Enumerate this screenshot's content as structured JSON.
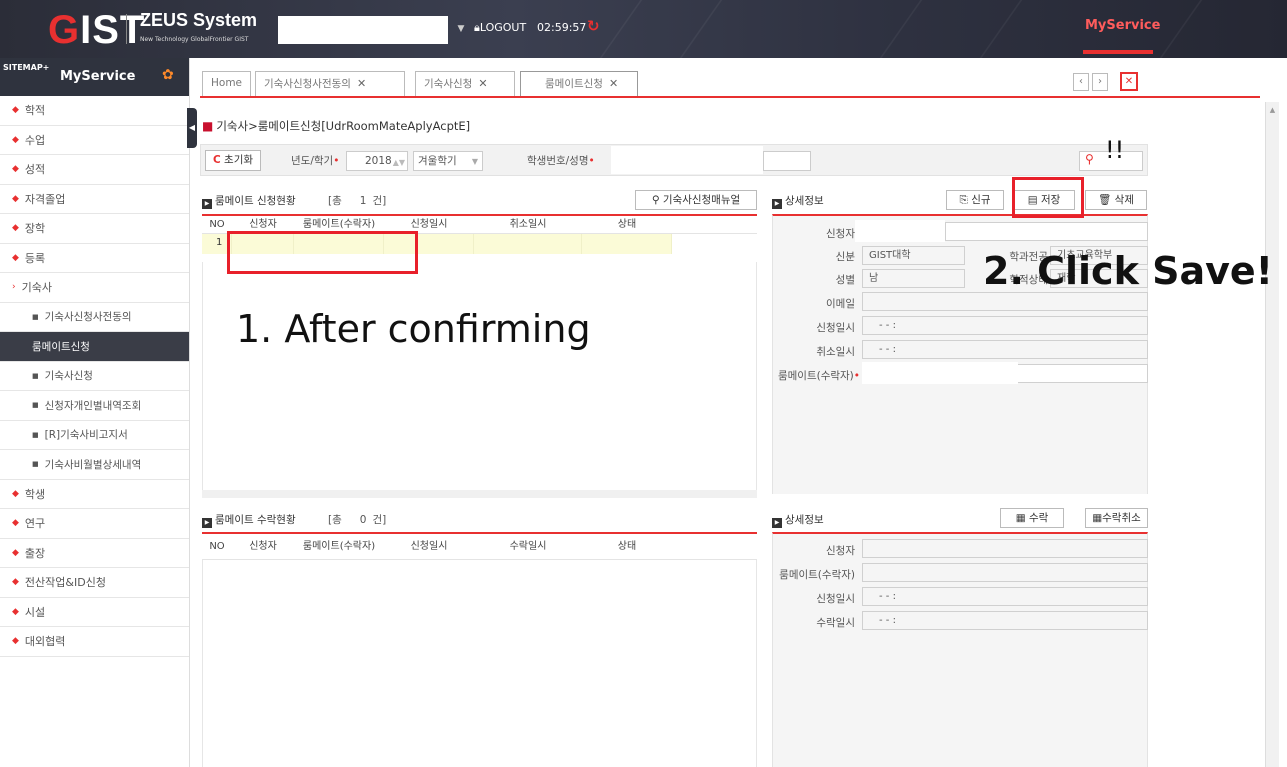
{
  "header": {
    "logo": {
      "g": "G",
      "rest": "IST"
    },
    "system_name": "ZEUS System",
    "system_sub": "New Technology GlobalFrontier GIST",
    "logout": "LOGOUT",
    "timer": "02:59:57",
    "myservice": "MyService"
  },
  "sidebar": {
    "sitemap": "SITEMAP+",
    "title": "MyService",
    "items": [
      {
        "label": "학적",
        "level": 1
      },
      {
        "label": "수업",
        "level": 1
      },
      {
        "label": "성적",
        "level": 1
      },
      {
        "label": "자격졸업",
        "level": 1
      },
      {
        "label": "장학",
        "level": 1
      },
      {
        "label": "등록",
        "level": 1
      },
      {
        "label": "기숙사",
        "level": 1,
        "open": true
      },
      {
        "label": "기숙사신청사전동의",
        "level": 2
      },
      {
        "label": "룸메이트신청",
        "level": 2,
        "active": true
      },
      {
        "label": "기숙사신청",
        "level": 2
      },
      {
        "label": "신청자개인별내역조회",
        "level": 2
      },
      {
        "label": "[R]기숙사비고지서",
        "level": 2
      },
      {
        "label": "기숙사비월별상세내역",
        "level": 2
      },
      {
        "label": "학생",
        "level": 1
      },
      {
        "label": "연구",
        "level": 1
      },
      {
        "label": "출장",
        "level": 1
      },
      {
        "label": "전산작업&ID신청",
        "level": 1
      },
      {
        "label": "시설",
        "level": 1
      },
      {
        "label": "대외협력",
        "level": 1
      }
    ]
  },
  "tabs": [
    {
      "label": "Home",
      "closable": false
    },
    {
      "label": "기숙사신청사전동의",
      "closable": true
    },
    {
      "label": "기숙사신청",
      "closable": true
    },
    {
      "label": "룸메이트신청",
      "closable": true,
      "active": true
    }
  ],
  "page_title": "기숙사>룸메이트신청[UdrRoomMateAplyAcptE]",
  "search": {
    "reset": "초기화",
    "year_label": "년도/학기",
    "year": "2018",
    "semester": "겨울학기",
    "student_label": "학생번호/성명"
  },
  "apply_list": {
    "title": "룸메이트 신청현황",
    "count_prefix": "[총",
    "count": "1",
    "count_suffix": "건]",
    "manual_button": "기숙사신청매뉴얼",
    "columns": [
      "NO",
      "신청자",
      "룸메이트(수락자)",
      "신청일시",
      "취소일시",
      "상태"
    ],
    "rows": [
      [
        "1",
        "",
        "",
        "",
        "",
        ""
      ]
    ]
  },
  "apply_detail": {
    "title": "상세정보",
    "new": "신규",
    "save": "저장",
    "delete": "삭제",
    "fields": {
      "applicant_label": "신청자",
      "identity_label": "신분",
      "identity_value": "GIST대학",
      "dept_label": "학과전공",
      "dept_value": "기초교육학부",
      "gender_label": "성별",
      "gender_value": "남",
      "status_label": "학적상태",
      "status_value": "재학",
      "email_label": "이메일",
      "apply_date_label": "신청일시",
      "cancel_date_label": "취소일시",
      "date_placeholder": "- -   :",
      "roommate_label": "룸메이트(수락자)"
    }
  },
  "accept_list": {
    "title": "룸메이트 수락현황",
    "count_prefix": "[총",
    "count": "0",
    "count_suffix": "건]",
    "columns": [
      "NO",
      "신청자",
      "룸메이트(수락자)",
      "신청일시",
      "수락일시",
      "상태"
    ]
  },
  "accept_detail": {
    "title": "상세정보",
    "accept": "수락",
    "cancel_accept": "수락취소",
    "applicant_label": "신청자",
    "roommate_label": "룸메이트(수락자)",
    "apply_date_label": "신청일시",
    "accept_date_label": "수락일시",
    "date_placeholder": "- -   :"
  },
  "annotations": {
    "step1": "1. After confirming",
    "step2": "2. Click Save!",
    "exclaim": "!!"
  }
}
